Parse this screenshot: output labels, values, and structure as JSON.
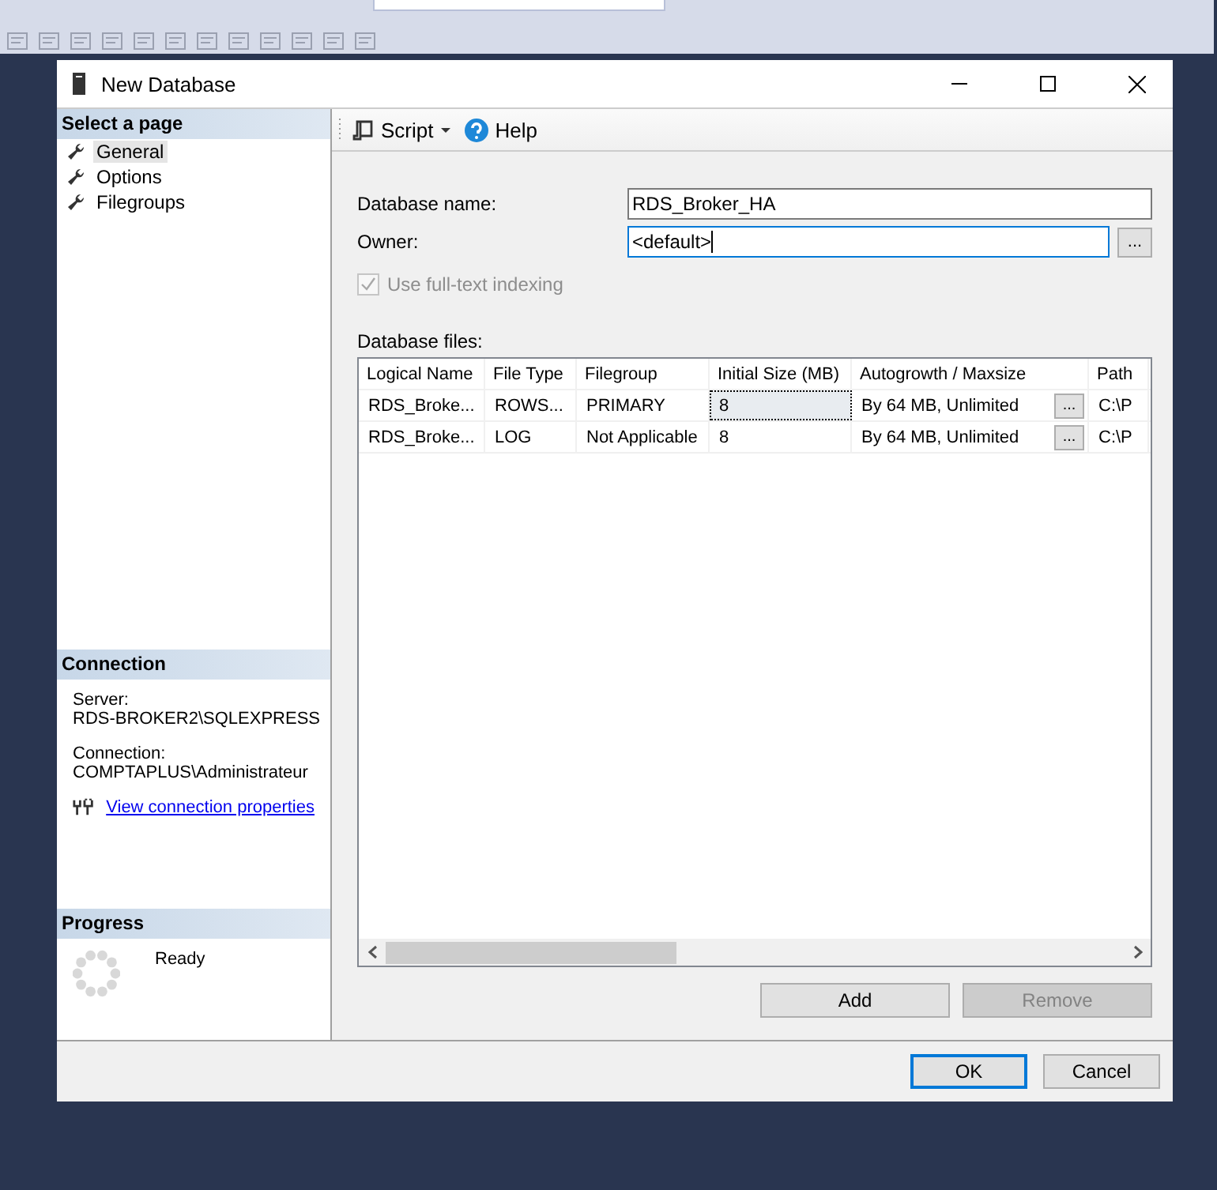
{
  "window": {
    "title": "New Database"
  },
  "sidebar": {
    "heading": "Select a page",
    "items": [
      {
        "label": "General",
        "selected": true
      },
      {
        "label": "Options",
        "selected": false
      },
      {
        "label": "Filegroups",
        "selected": false
      }
    ]
  },
  "connection": {
    "heading": "Connection",
    "server_label": "Server:",
    "server": "RDS-BROKER2\\SQLEXPRESS",
    "connection_label": "Connection:",
    "connection": "COMPTAPLUS\\Administrateur",
    "link": "View connection properties"
  },
  "progress": {
    "heading": "Progress",
    "status": "Ready"
  },
  "toolbar": {
    "script": "Script",
    "help": "Help"
  },
  "form": {
    "name_label": "Database name:",
    "name_value": "RDS_Broker_HA",
    "owner_label": "Owner:",
    "owner_value": "<default>",
    "owner_focused": true,
    "browse": "...",
    "fulltext": {
      "label": "Use full-text indexing",
      "checked": true,
      "disabled": true
    }
  },
  "files": {
    "label": "Database files:",
    "columns": [
      "Logical Name",
      "File Type",
      "Filegroup",
      "Initial Size (MB)",
      "Autogrowth / Maxsize",
      "Path"
    ],
    "rows": [
      {
        "cells": [
          "RDS_Broke...",
          "ROWS...",
          "PRIMARY",
          "8",
          "By 64 MB, Unlimited",
          "C:\\P"
        ],
        "button": "...",
        "selected": true
      },
      {
        "cells": [
          "RDS_Broke...",
          "LOG",
          "Not Applicable",
          "8",
          "By 64 MB, Unlimited",
          "C:\\P"
        ],
        "button": "...",
        "selected": false
      }
    ]
  },
  "file_buttons": [
    {
      "label": "Add",
      "disabled": false
    },
    {
      "label": "Remove",
      "disabled": true
    }
  ],
  "buttons": [
    {
      "label": "OK",
      "default": true
    },
    {
      "label": "Cancel",
      "default": false
    }
  ]
}
